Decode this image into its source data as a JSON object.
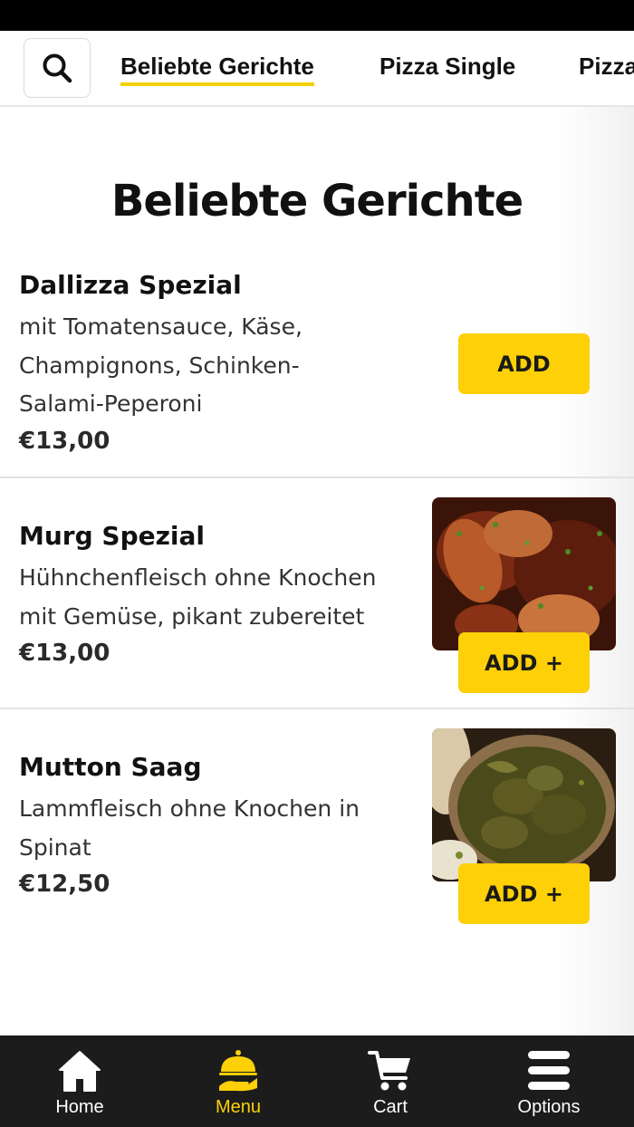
{
  "header": {
    "tabs": [
      {
        "label": "Beliebte Gerichte",
        "active": true
      },
      {
        "label": "Pizza Single",
        "active": false
      },
      {
        "label": "Pizza",
        "active": false
      }
    ]
  },
  "section": {
    "title": "Beliebte Gerichte"
  },
  "items": [
    {
      "name": "Dallizza Spezial",
      "description": "mit Tomatensauce, Käse, Champignons, Schinken-Salami-Peperoni",
      "price": "€13,00",
      "button": "ADD",
      "has_image": false
    },
    {
      "name": "Murg Spezial",
      "description": "Hühnchenfleisch ohne Knochen mit Gemüse, pikant zubereitet",
      "price": "€13,00",
      "button": "ADD +",
      "has_image": true
    },
    {
      "name": "Mutton Saag",
      "description": "Lammfleisch ohne Knochen in Spinat",
      "price": "€12,50",
      "button": "ADD +",
      "has_image": true
    }
  ],
  "bottom_nav": [
    {
      "label": "Home",
      "icon": "home-icon",
      "active": false
    },
    {
      "label": "Menu",
      "icon": "food-cloche-icon",
      "active": true
    },
    {
      "label": "Cart",
      "icon": "cart-icon",
      "active": false
    },
    {
      "label": "Options",
      "icon": "hamburger-menu-icon",
      "active": false
    }
  ],
  "colors": {
    "accent": "#fdd007",
    "nav_background": "#1c1c1c",
    "status_bar": "#000000"
  }
}
